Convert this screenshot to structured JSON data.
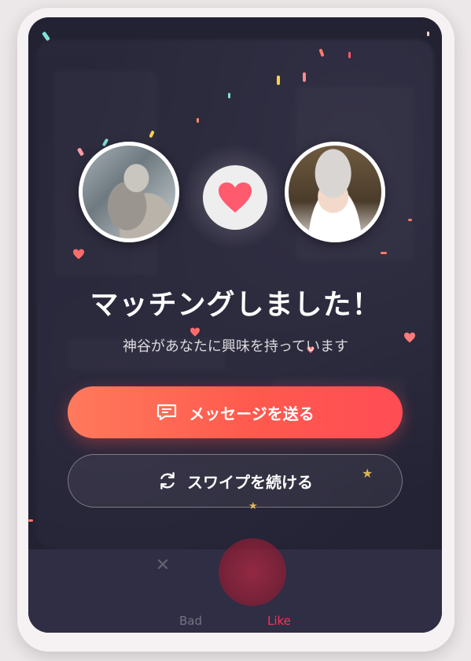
{
  "match": {
    "title": "マッチングしました！",
    "subtitle": "神谷があなたに興味を持っています",
    "left_avatar": "cat-photo",
    "right_avatar": "person-photo",
    "center_icon": "heart-icon"
  },
  "actions": {
    "send_message_label": "メッセージを送る",
    "send_message_icon": "message-icon",
    "continue_swipe_label": "スワイプを続ける",
    "continue_swipe_icon": "refresh-icon"
  },
  "bottom_bar": {
    "bad_label": "Bad",
    "like_label": "Like"
  },
  "colors": {
    "accent": "#ff5a4e",
    "heart": "#ff5a6e",
    "overlay": "#2b2a3d"
  }
}
